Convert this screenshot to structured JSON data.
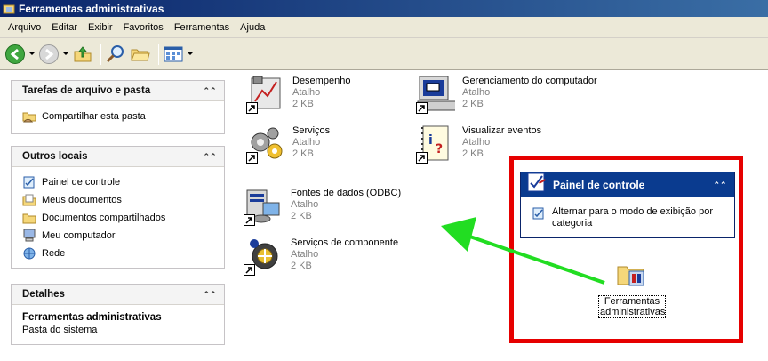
{
  "window": {
    "title": "Ferramentas administrativas"
  },
  "menu": [
    "Arquivo",
    "Editar",
    "Exibir",
    "Favoritos",
    "Ferramentas",
    "Ajuda"
  ],
  "toolbar": {
    "icons": [
      "back-icon",
      "forward-icon",
      "up-folder-icon",
      "search-icon",
      "folders-icon",
      "views-icon"
    ]
  },
  "sidebar": {
    "tasks": {
      "title": "Tarefas de arquivo e pasta",
      "items": [
        {
          "label": "Compartilhar esta pasta",
          "icon": "share-folder-icon"
        }
      ]
    },
    "other_places": {
      "title": "Outros locais",
      "items": [
        {
          "label": "Painel de controle",
          "icon": "control-panel-icon"
        },
        {
          "label": "Meus documentos",
          "icon": "my-documents-icon"
        },
        {
          "label": "Documentos compartilhados",
          "icon": "shared-documents-icon"
        },
        {
          "label": "Meu computador",
          "icon": "my-computer-icon"
        },
        {
          "label": "Rede",
          "icon": "network-icon"
        }
      ]
    },
    "details": {
      "title": "Detalhes",
      "name": "Ferramentas administrativas",
      "type": "Pasta do sistema"
    }
  },
  "files": [
    {
      "name": "Desempenho",
      "type": "Atalho",
      "size": "2 KB",
      "icon": "performance-icon"
    },
    {
      "name": "Gerenciamento do computador",
      "type": "Atalho",
      "size": "2 KB",
      "icon": "computer-management-icon"
    },
    {
      "name": "Serviços",
      "type": "Atalho",
      "size": "2 KB",
      "icon": "services-icon"
    },
    {
      "name": "Visualizar eventos",
      "type": "Atalho",
      "size": "2 KB",
      "icon": "event-viewer-icon"
    },
    {
      "name": "Fontes de dados (ODBC)",
      "type": "Atalho",
      "size": "2 KB",
      "icon": "odbc-icon"
    },
    {
      "name": "Serviços de componente",
      "type": "Atalho",
      "size": "2 KB",
      "icon": "component-services-icon"
    }
  ],
  "callout": {
    "panel_title": "Painel de controle",
    "switch_link": "Alternar para o modo de exibição por categoria",
    "folder_label": "Ferramentas administrativas",
    "colors": {
      "box": "#e60000",
      "arrow": "#22dd22"
    }
  }
}
